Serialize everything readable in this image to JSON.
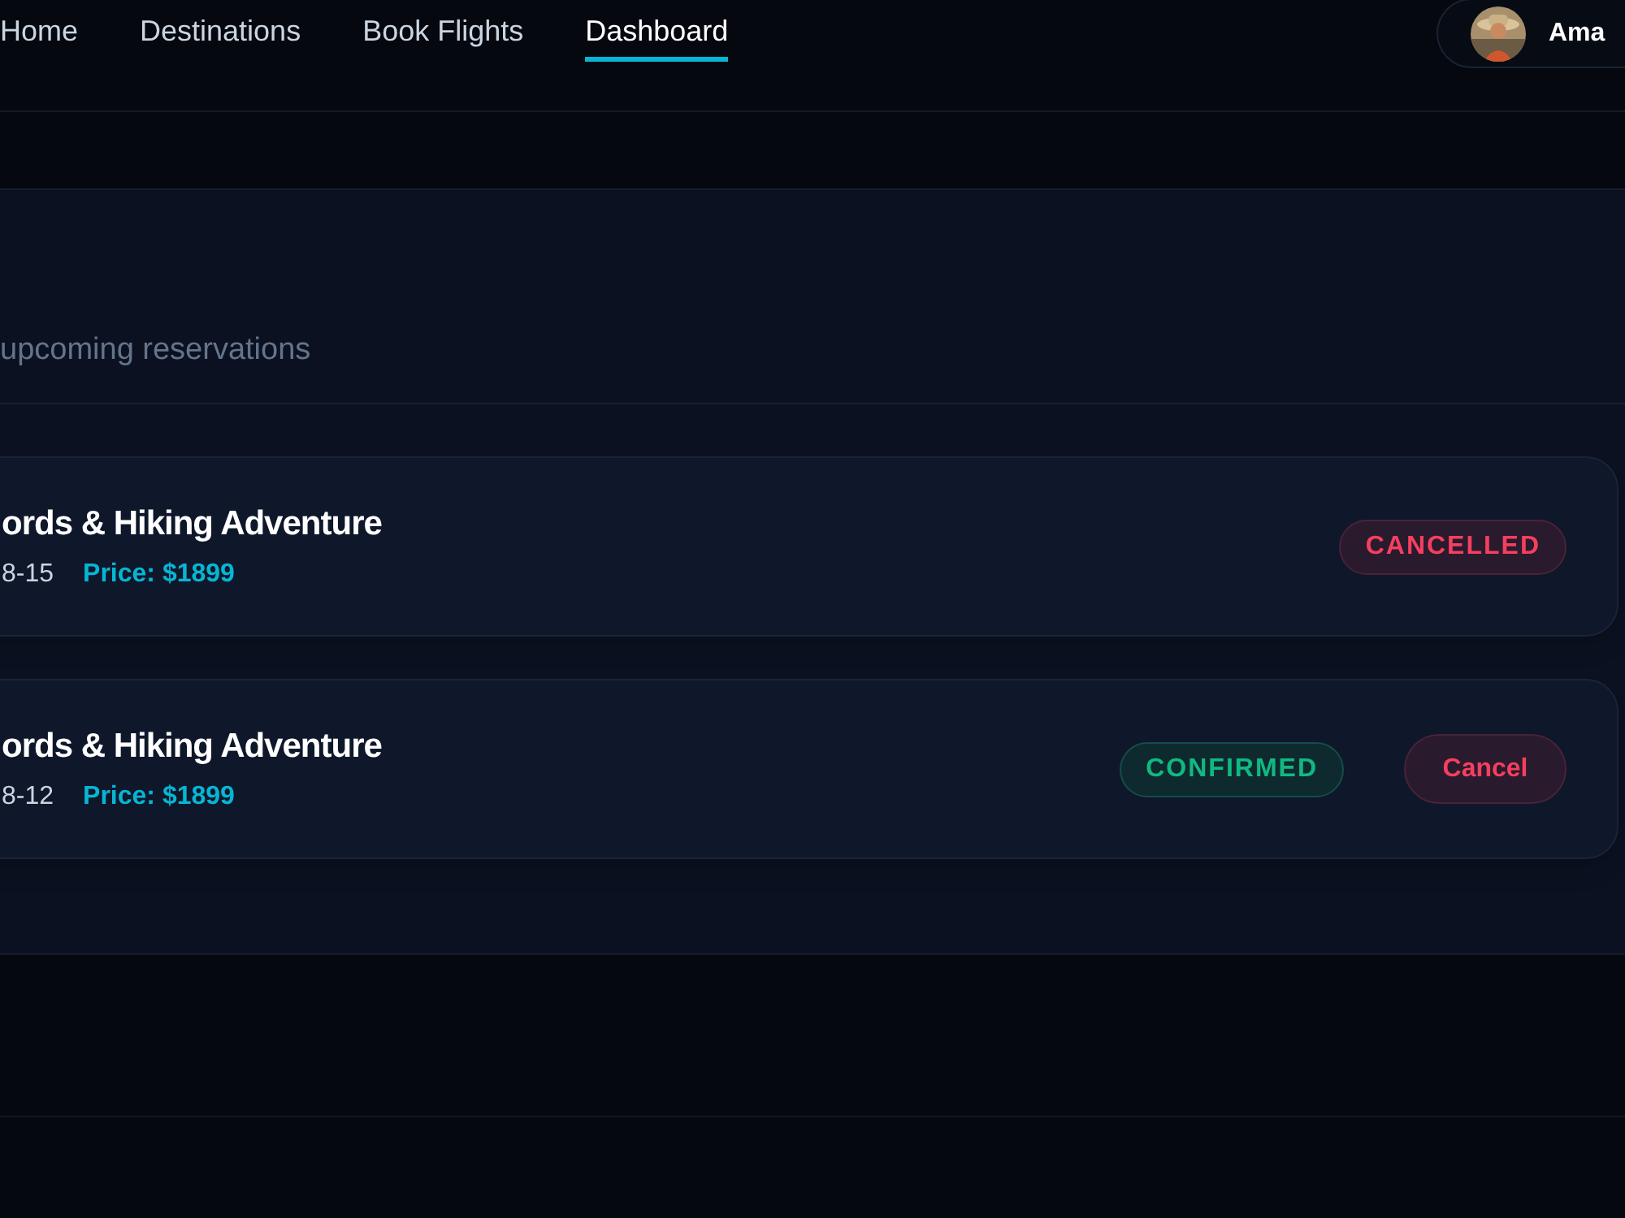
{
  "nav": {
    "links": [
      {
        "label": "Home",
        "selected": false
      },
      {
        "label": "Destinations",
        "selected": false
      },
      {
        "label": "Book Flights",
        "selected": false
      },
      {
        "label": "Dashboard",
        "selected": true
      }
    ],
    "user": {
      "name": "Ama"
    }
  },
  "reservations_panel": {
    "subtitle": "upcoming reservations",
    "bookings": [
      {
        "title": "ords & Hiking Adventure",
        "date": "8-15",
        "price": "Price: $1899",
        "status": {
          "kind": "cancelled",
          "label": "CANCELLED"
        }
      },
      {
        "title": "ords & Hiking Adventure",
        "date": "8-12",
        "price": "Price: $1899",
        "status": {
          "kind": "confirmed",
          "label": "CONFIRMED"
        },
        "action": "Cancel"
      }
    ]
  }
}
